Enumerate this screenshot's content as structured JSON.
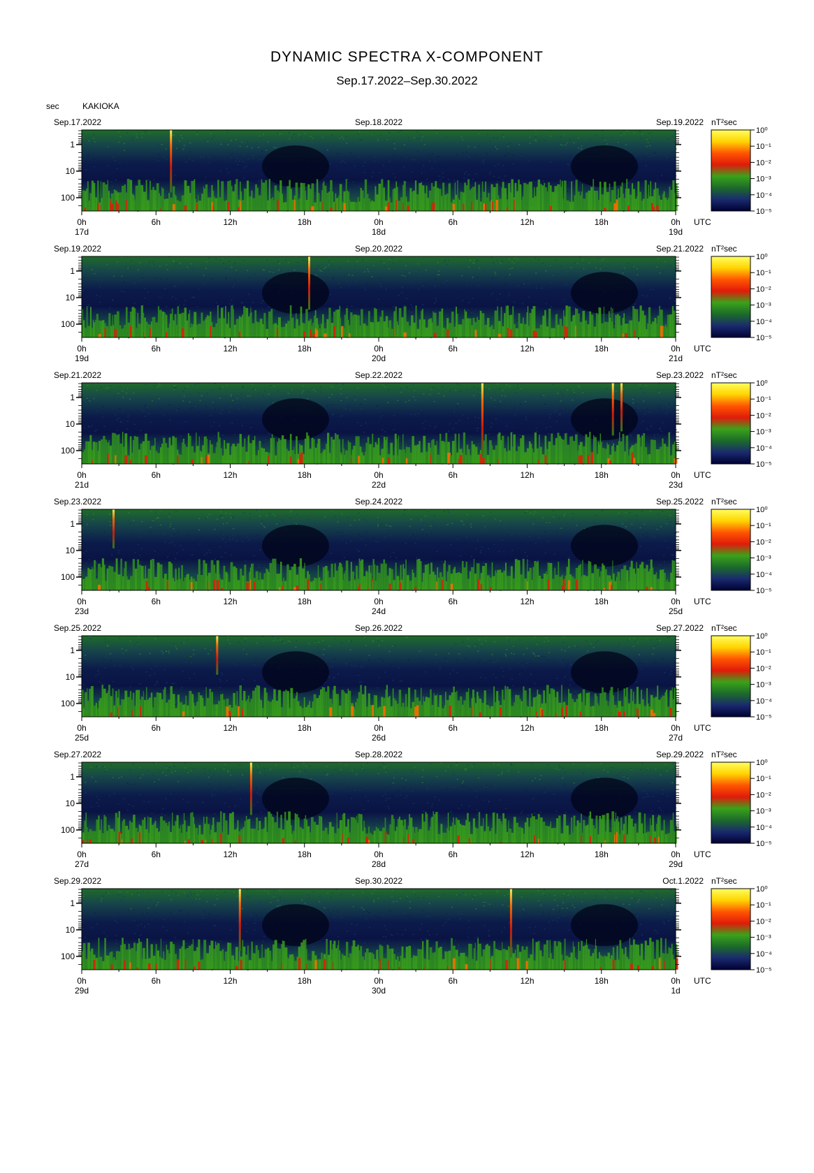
{
  "title": "DYNAMIC SPECTRA X-COMPONENT",
  "subtitle": "Sep.17.2022–Sep.30.2022",
  "y_unit": "sec",
  "station": "KAKIOKA",
  "colorbar_unit": "nT²sec",
  "x_unit": "UTC",
  "chart_data": {
    "type": "heatmap",
    "ylabel": "sec",
    "y_scale": "log",
    "y_ticks": [
      "1",
      "10",
      "100"
    ],
    "x_ticks": [
      "0h",
      "6h",
      "12h",
      "18h",
      "0h",
      "6h",
      "12h",
      "18h",
      "0h"
    ],
    "colorbar_ticks": [
      "10⁰",
      "10⁻¹",
      "10⁻²",
      "10⁻³",
      "10⁻⁴",
      "10⁻⁵"
    ],
    "colorscale": [
      "#000033",
      "#1a2a6e",
      "#1c6b2a",
      "#3aa21a",
      "#e01b0b",
      "#ff5500",
      "#ffd400",
      "#fffe60"
    ],
    "panels": [
      {
        "date_left": "Sep.17.2022",
        "date_mid": "Sep.18.2022",
        "date_right": "Sep.19.2022",
        "day_left": "17d",
        "day_mid": "18d",
        "day_right": "19d"
      },
      {
        "date_left": "Sep.19.2022",
        "date_mid": "Sep.20.2022",
        "date_right": "Sep.21.2022",
        "day_left": "19d",
        "day_mid": "20d",
        "day_right": "21d"
      },
      {
        "date_left": "Sep.21.2022",
        "date_mid": "Sep.22.2022",
        "date_right": "Sep.23.2022",
        "day_left": "21d",
        "day_mid": "22d",
        "day_right": "23d"
      },
      {
        "date_left": "Sep.23.2022",
        "date_mid": "Sep.24.2022",
        "date_right": "Sep.25.2022",
        "day_left": "23d",
        "day_mid": "24d",
        "day_right": "25d"
      },
      {
        "date_left": "Sep.25.2022",
        "date_mid": "Sep.26.2022",
        "date_right": "Sep.27.2022",
        "day_left": "25d",
        "day_mid": "26d",
        "day_right": "27d"
      },
      {
        "date_left": "Sep.27.2022",
        "date_mid": "Sep.28.2022",
        "date_right": "Sep.29.2022",
        "day_left": "27d",
        "day_mid": "28d",
        "day_right": "29d"
      },
      {
        "date_left": "Sep.29.2022",
        "date_mid": "Sep.30.2022",
        "date_right": "Oct.1.2022",
        "day_left": "29d",
        "day_mid": "30d",
        "day_right": "1d"
      }
    ]
  }
}
